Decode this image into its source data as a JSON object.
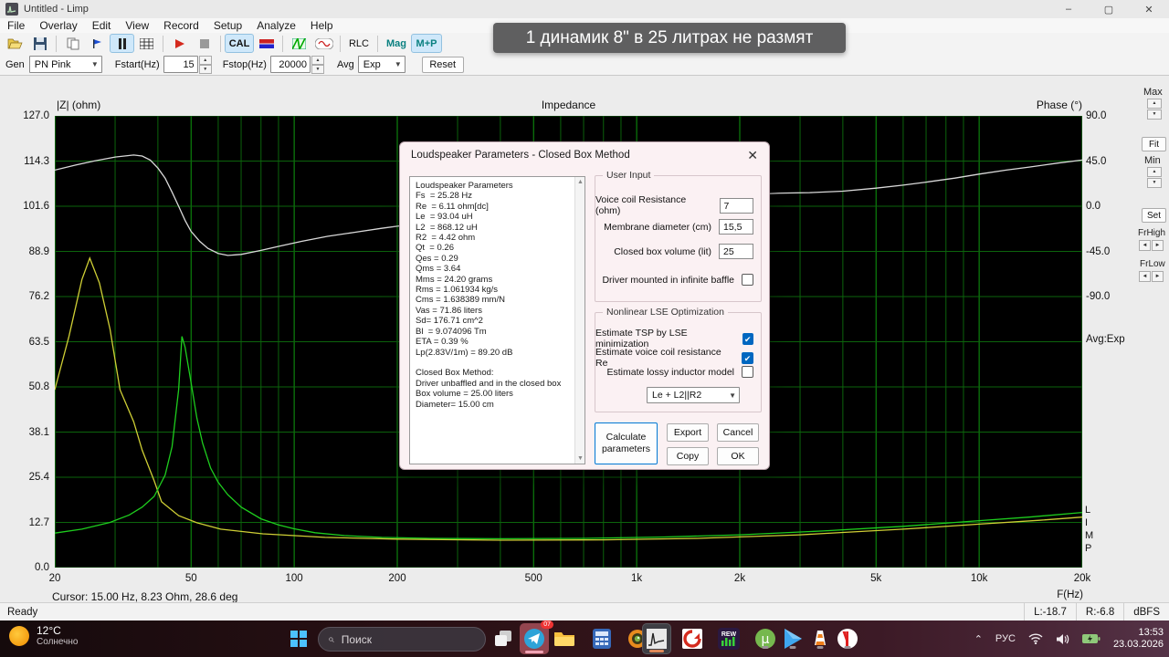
{
  "window": {
    "title": "Untitled - Limp",
    "minimize": "–",
    "maximize": "▢",
    "close": "✕"
  },
  "menu": {
    "items": [
      "File",
      "Overlay",
      "Edit",
      "View",
      "Record",
      "Setup",
      "Analyze",
      "Help"
    ]
  },
  "toolbar": {
    "icons": [
      "open-file",
      "save",
      "copy",
      "overlay-flag",
      "pause",
      "table",
      "record-play",
      "stop",
      "calibrate",
      "level-bars",
      "spectrum",
      "generator-sine"
    ],
    "cal_label": "CAL",
    "rlc_label": "RLC",
    "mag_label": "Mag",
    "mp_label": "M+P"
  },
  "controls_row": {
    "gen_label": "Gen",
    "gen_value": "PN Pink",
    "fstart_label": "Fstart(Hz)",
    "fstart_value": "15",
    "fstop_label": "Fstop(Hz)",
    "fstop_value": "20000",
    "avg_label": "Avg",
    "avg_value": "Exp",
    "reset_label": "Reset"
  },
  "caption": {
    "text": "1 динамик 8\" в 25 литрах не размят"
  },
  "chart": {
    "left_axis_label": "|Z| (ohm)",
    "title": "Impedance",
    "right_axis_label": "Phase (°)",
    "avg_text": "Avg:Exp",
    "watermark": "LIMP",
    "xlabel": "F(Hz)",
    "cursor_text": "Cursor: 15.00 Hz, 8.23 Ohm, 28.6 deg"
  },
  "chart_data": {
    "type": "line",
    "x_scale": "log",
    "x_range_hz": [
      20,
      20000
    ],
    "y_left_label": "|Z| (ohm)",
    "y_left_range": [
      0,
      127
    ],
    "y_left_ticks": [
      "127.0",
      "114.3",
      "101.6",
      "88.9",
      "76.2",
      "63.5",
      "50.8",
      "38.1",
      "25.4",
      "12.7",
      "0.0"
    ],
    "y_right_label": "Phase (°)",
    "y_right_range": [
      -90,
      90
    ],
    "y_right_ticks": [
      "90.0",
      "45.0",
      "0.0",
      "-45.0",
      "-90.0"
    ],
    "x_ticks": [
      {
        "label": "20",
        "f": 20
      },
      {
        "label": "50",
        "f": 50
      },
      {
        "label": "100",
        "f": 100
      },
      {
        "label": "200",
        "f": 200
      },
      {
        "label": "500",
        "f": 500
      },
      {
        "label": "1k",
        "f": 1000
      },
      {
        "label": "2k",
        "f": 2000
      },
      {
        "label": "5k",
        "f": 5000
      },
      {
        "label": "10k",
        "f": 10000
      },
      {
        "label": "20k",
        "f": 20000
      }
    ],
    "grid_color_minor": "#0c640c",
    "grid_color_major": "#0f9b0f",
    "plot_bg": "#000000",
    "series": [
      {
        "name": "phase-deg",
        "axis": "deg",
        "color": "#d9d9d9",
        "points": [
          [
            20,
            36
          ],
          [
            23,
            41
          ],
          [
            26,
            45
          ],
          [
            30,
            49
          ],
          [
            34,
            51
          ],
          [
            36,
            50
          ],
          [
            38,
            46
          ],
          [
            40,
            38
          ],
          [
            42,
            28
          ],
          [
            44,
            14
          ],
          [
            46,
            0
          ],
          [
            48,
            -14
          ],
          [
            50,
            -25
          ],
          [
            53,
            -35
          ],
          [
            56,
            -42
          ],
          [
            60,
            -47
          ],
          [
            64,
            -49
          ],
          [
            70,
            -48
          ],
          [
            80,
            -44
          ],
          [
            90,
            -40
          ],
          [
            105,
            -35
          ],
          [
            125,
            -30
          ],
          [
            150,
            -26
          ],
          [
            180,
            -22
          ],
          [
            220,
            -18
          ],
          [
            260,
            -15
          ],
          [
            350,
            -10
          ],
          [
            500,
            -5
          ],
          [
            700,
            0
          ],
          [
            1000,
            4
          ],
          [
            1400,
            8
          ],
          [
            2000,
            11
          ],
          [
            2600,
            13
          ],
          [
            3200,
            13.5
          ],
          [
            4000,
            15
          ],
          [
            5000,
            18
          ],
          [
            6000,
            21
          ],
          [
            7000,
            24
          ],
          [
            8500,
            28
          ],
          [
            10000,
            32
          ],
          [
            12000,
            36
          ],
          [
            14000,
            39
          ],
          [
            17000,
            43
          ],
          [
            20000,
            46
          ]
        ]
      },
      {
        "name": "impedance-free-air",
        "axis": "ohm",
        "color": "#cfcf35",
        "points": [
          [
            20,
            50
          ],
          [
            22,
            65
          ],
          [
            24,
            81
          ],
          [
            25.3,
            87
          ],
          [
            27,
            80
          ],
          [
            29,
            67
          ],
          [
            31,
            50
          ],
          [
            34,
            41
          ],
          [
            36,
            33
          ],
          [
            39,
            24.4
          ],
          [
            41,
            18.5
          ],
          [
            46,
            14.6
          ],
          [
            52,
            12.6
          ],
          [
            61,
            10.8
          ],
          [
            81,
            9.5
          ],
          [
            123,
            8.5
          ],
          [
            200,
            8.0
          ],
          [
            400,
            7.7
          ],
          [
            800,
            7.8
          ],
          [
            1500,
            8.2
          ],
          [
            3000,
            9.2
          ],
          [
            6000,
            10.8
          ],
          [
            10000,
            12.2
          ],
          [
            15000,
            13.3
          ],
          [
            20000,
            14.2
          ]
        ]
      },
      {
        "name": "impedance-closed-box",
        "axis": "ohm",
        "color": "#1ecd1e",
        "points": [
          [
            20,
            9.7
          ],
          [
            24,
            10.8
          ],
          [
            29,
            12.7
          ],
          [
            33,
            14.8
          ],
          [
            36,
            17
          ],
          [
            39,
            20
          ],
          [
            42,
            26
          ],
          [
            44,
            34
          ],
          [
            46,
            50
          ],
          [
            47,
            65
          ],
          [
            48,
            62
          ],
          [
            50,
            52
          ],
          [
            52,
            42
          ],
          [
            54,
            35
          ],
          [
            57,
            28
          ],
          [
            60,
            24
          ],
          [
            64,
            20.5
          ],
          [
            70,
            17
          ],
          [
            80,
            13.7
          ],
          [
            90,
            12
          ],
          [
            100,
            10.9
          ],
          [
            115,
            9.8
          ],
          [
            140,
            9.0
          ],
          [
            180,
            8.5
          ],
          [
            250,
            8.2
          ],
          [
            400,
            8.1
          ],
          [
            700,
            8.2
          ],
          [
            1200,
            8.6
          ],
          [
            2000,
            9.2
          ],
          [
            3500,
            10.3
          ],
          [
            6000,
            11.6
          ],
          [
            10000,
            13.2
          ],
          [
            14000,
            14.2
          ],
          [
            20000,
            15.5
          ]
        ]
      }
    ]
  },
  "side_panel": {
    "max_label": "Max",
    "fit_label": "Fit",
    "min_label": "Min",
    "set_label": "Set",
    "frhigh_label": "FrHigh",
    "frlow_label": "FrLow",
    "up": "▲",
    "down": "▼",
    "left": "◄",
    "right": "►"
  },
  "status_bar": {
    "ready": "Ready",
    "l_level": "L:-18.7",
    "r_level": "R:-6.8",
    "unit": "dBFS"
  },
  "dialog": {
    "title": "Loudspeaker Parameters - Closed Box Method",
    "close": "✕",
    "report_lines": [
      "Loudspeaker Parameters",
      "Fs  = 25.28 Hz",
      "Re  = 6.11 ohm[dc]",
      "Le  = 93.04 uH",
      "L2  = 868.12 uH",
      "R2  = 4.42 ohm",
      "Qt  = 0.26",
      "Qes = 0.29",
      "Qms = 3.64",
      "Mms = 24.20 grams",
      "Rms = 1.061934 kg/s",
      "Cms = 1.638389 mm/N",
      "Vas = 71.86 liters",
      "Sd= 176.71 cm^2",
      "Bl  = 9.074096 Tm",
      "ETA = 0.39 %",
      "Lp(2.83V/1m) = 89.20 dB",
      "",
      "Closed Box Method:",
      "Driver unbaffled and in the closed box",
      "Box volume = 25.00 liters",
      "Diameter= 15.00 cm"
    ],
    "user_input": {
      "legend": "User Input",
      "fields": [
        {
          "label": "Voice coil Resistance (ohm)",
          "value": "7"
        },
        {
          "label": "Membrane diameter (cm)",
          "value": "15,5"
        },
        {
          "label": "Closed box volume (lit)",
          "value": "25"
        }
      ],
      "baffle_label": "Driver mounted in infinite baffle",
      "baffle_checked": false
    },
    "lse": {
      "legend": "Nonlinear LSE Optimization",
      "checks": [
        {
          "label": "Estimate TSP by LSE minimization",
          "checked": true
        },
        {
          "label": "Estimate voice coil resistance Re",
          "checked": true
        },
        {
          "label": "Estimate lossy inductor model",
          "checked": false
        }
      ],
      "model_value": "Le + L2||R2"
    },
    "buttons": {
      "calculate": "Calculate parameters",
      "export": "Export",
      "cancel": "Cancel",
      "copy": "Copy",
      "ok": "OK"
    }
  },
  "taskbar": {
    "weather": {
      "temp": "12°C",
      "condition": "Солнечно"
    },
    "search": {
      "placeholder": "Поиск"
    },
    "telegram_badge": "07",
    "rew_label": "REW",
    "tray": {
      "chevron": "⌃",
      "lang": "РУС",
      "time": "13:53",
      "date": "23.03.2026"
    }
  }
}
